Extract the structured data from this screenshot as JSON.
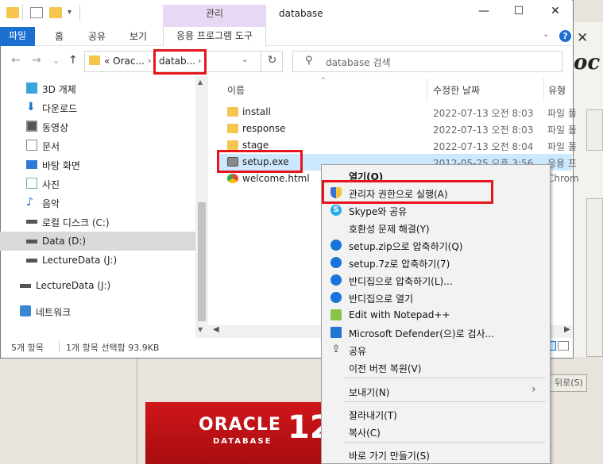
{
  "window": {
    "title": "database",
    "context_tab_group": "관리",
    "minimize": "—",
    "maximize": "☐",
    "close": "✕"
  },
  "ribbon": {
    "tabs": [
      "파일",
      "홈",
      "공유",
      "보기",
      "응용 프로그램 도구"
    ],
    "chevron": "⌄",
    "help": "?"
  },
  "address": {
    "back": "←",
    "forward": "→",
    "recent": "⌄",
    "up": "↑",
    "prefix": "«",
    "crumb1": "Orac...",
    "separator": "›",
    "crumb2": "datab...",
    "dropdown": "⌄",
    "refresh": "↻",
    "search_placeholder": "database 검색"
  },
  "nav_pane": {
    "items": [
      {
        "label": "3D 개체",
        "icon": "3d-objects-icon"
      },
      {
        "label": "다운로드",
        "icon": "download-icon"
      },
      {
        "label": "동영상",
        "icon": "video-icon"
      },
      {
        "label": "문서",
        "icon": "document-icon"
      },
      {
        "label": "바탕 화면",
        "icon": "desktop-icon"
      },
      {
        "label": "사진",
        "icon": "pictures-icon"
      },
      {
        "label": "음악",
        "icon": "music-icon"
      },
      {
        "label": "로컬 디스크 (C:)",
        "icon": "drive-icon"
      },
      {
        "label": "Data (D:)",
        "icon": "drive-icon"
      },
      {
        "label": "LectureData (J:)",
        "icon": "drive-icon"
      },
      {
        "label": "LectureData (J:)",
        "icon": "drive-icon"
      },
      {
        "label": "네트워크",
        "icon": "network-icon"
      }
    ],
    "selected_index": 8
  },
  "file_list": {
    "columns": {
      "name": "이름",
      "modified": "수정한 날짜",
      "type": "유형"
    },
    "rows": [
      {
        "name": "install",
        "modified": "2022-07-13 오전 8:03",
        "type": "파일 폴",
        "icon": "folder-icon"
      },
      {
        "name": "response",
        "modified": "2022-07-13 오전 8:03",
        "type": "파일 폴",
        "icon": "folder-icon"
      },
      {
        "name": "stage",
        "modified": "2022-07-13 오전 8:04",
        "type": "파일 폴",
        "icon": "folder-icon"
      },
      {
        "name": "setup.exe",
        "modified": "2012-05-25 오후 3:56",
        "type": "응용 프",
        "icon": "exe-icon"
      },
      {
        "name": "welcome.html",
        "modified": "",
        "type": "Chrom",
        "icon": "chrome-html-icon"
      }
    ],
    "selected_index": 3
  },
  "status_bar": {
    "item_count": "5개 항목",
    "selection": "1개 항목 선택함 93.9KB"
  },
  "context_menu": {
    "items": [
      {
        "label": "열기(O)",
        "icon": ""
      },
      {
        "label": "관리자 권한으로 실행(A)",
        "icon": "uac-shield-icon"
      },
      {
        "label": "Skype와 공유",
        "icon": "skype-icon"
      },
      {
        "label": "호환성 문제 해결(Y)",
        "icon": ""
      },
      {
        "label": "setup.zip으로 압축하기(Q)",
        "icon": "bandizip-icon"
      },
      {
        "label": "setup.7z로 압축하기(7)",
        "icon": "bandizip-icon"
      },
      {
        "label": "반디집으로 압축하기(L)...",
        "icon": "bandizip-icon"
      },
      {
        "label": "반디집으로 열기",
        "icon": "bandizip-icon"
      },
      {
        "label": "Edit with Notepad++",
        "icon": "notepad-plus-plus-icon"
      },
      {
        "label": "Microsoft Defender(으)로 검사...",
        "icon": "defender-icon"
      },
      {
        "label": "공유",
        "icon": "share-icon"
      },
      {
        "label": "이전 버전 복원(V)",
        "icon": ""
      },
      {
        "label": "보내기(N)",
        "icon": ""
      },
      {
        "label": "잘라내기(T)",
        "icon": ""
      },
      {
        "label": "복사(C)",
        "icon": ""
      },
      {
        "label": "바로 가기 만들기(S)",
        "icon": ""
      }
    ],
    "submenu_arrow": "›"
  },
  "background_window": {
    "close": "✕",
    "logo_fragment": "oc",
    "back_button": "뒤로(S)",
    "banner_oracle": "ORACLE",
    "banner_database": "DATABASE",
    "banner_version": "12"
  },
  "colors": {
    "accent": "#1a6fcf",
    "highlight_box": "#e6141c",
    "selection": "#cce8ff",
    "oracle_red": "#c8161a"
  }
}
